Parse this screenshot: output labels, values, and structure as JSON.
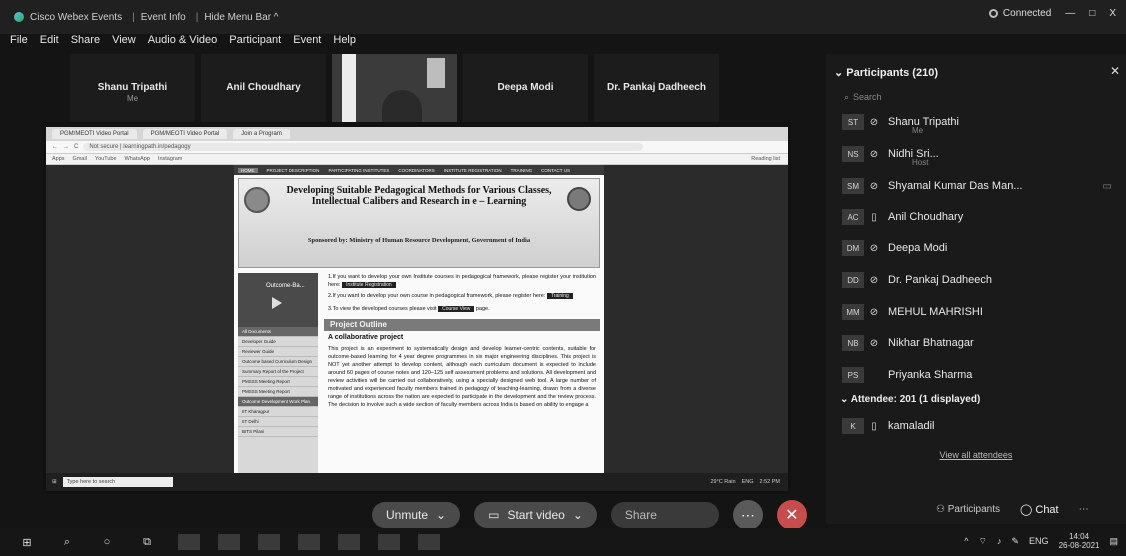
{
  "titlebar": {
    "app": "Cisco Webex Events",
    "sep1": "|",
    "event_info": "Event Info",
    "sep2": "|",
    "hide_menu": "Hide Menu Bar ^",
    "connected": "Connected",
    "min": "—",
    "max": "□",
    "close": "X"
  },
  "menu": [
    "File",
    "Edit",
    "Share",
    "View",
    "Audio & Video",
    "Participant",
    "Event",
    "Help"
  ],
  "video_strip": [
    {
      "name": "Shanu Tripathi",
      "sub": "Me"
    },
    {
      "name": "Anil Choudhary",
      "sub": ""
    },
    {
      "name": "Deepa Modi",
      "sub": ""
    },
    {
      "name": "Dr. Pankaj Dadheech",
      "sub": ""
    }
  ],
  "browser": {
    "tab1": "PGM/MEOTI Video Portal",
    "tab2": "PGM/MEOTI Video Portal",
    "tab3": "Join a Program",
    "url": "Not secure | learningpath.in/pedagogy",
    "bookmarks": [
      "Apps",
      "Gmail",
      "YouTube",
      "WhatsApp",
      "Instagram"
    ],
    "reading_list": "Reading list"
  },
  "site": {
    "nav": [
      "HOME",
      "PROJECT DESCRIPTION",
      "PARTICIPATING INSTITUTES",
      "COORDINATORS",
      "INSTITUTE REGISTRATION",
      "TRAINING",
      "CONTACT US"
    ],
    "title": "Developing Suitable Pedagogical Methods for Various Classes, Intellectual Calibers and Research in e – Learning",
    "sponsor": "Sponsored by: Ministry of Human Resource Development, Government of India",
    "side_video": "Outcome-Ba...",
    "side_items": [
      "All Documents",
      "Developer Guide",
      "Reviewer Guide",
      "Outcome based Curriculum Design",
      "Summary Report of the Project",
      "PMSSS Meeting Report",
      "PMSSS Meeting Report",
      "Outcome Development Work Plan",
      "IIT Kharagpur",
      "IIT Delhi",
      "BITS Pilani"
    ],
    "p1": "1.If you want to develop your own Institute courses in pedagogical framework, please register your institution here:",
    "p1_btn": "Institute Registration",
    "p2": "2.If you want to develop your own course in pedagogical framework, please register here:",
    "p2_btn": "Training",
    "p3": "3.To view the developed courses please visit",
    "p3_btn": "Course View",
    "p3_end": "page.",
    "outline": "Project Outline",
    "collab": "A collaborative project",
    "body": "This project is an experiment to systematically design and develop learner-centric contents, suitable for outcome-based learning for 4 year degree programmes in six major engineering disciplines. This project is NOT yet another attempt to develop content, although each curriculum document is expected to include around 60 pages of course notes and 120–125 self assessment problems and solutions. All development and review activities will be carried out collaboratively, using a specially designed web tool. A large number of motivated and experienced faculty members trained in pedagogy of teaching-learning, drawn from a diverse range of institutions across the nation are expected to participate in the development and the review process. The decision to involve such a wide section of faculty members across India is based on ability to engage a"
  },
  "inner_taskbar": {
    "search": "Type here to search",
    "weather": "29°C Rain",
    "lang": "ENG",
    "time": "2:52 PM"
  },
  "controls": {
    "unmute": "Unmute",
    "start_video": "Start video",
    "share": "Share"
  },
  "panel": {
    "header": "Participants (210)",
    "search": "Search",
    "participants": [
      {
        "initials": "ST",
        "name": "Shanu Tripathi",
        "sub": "Me"
      },
      {
        "initials": "NS",
        "name": "Nidhi Sri...",
        "sub": "Host"
      },
      {
        "initials": "SM",
        "name": "Shyamal Kumar Das Man...",
        "sub": ""
      },
      {
        "initials": "AC",
        "name": "Anil Choudhary",
        "sub": ""
      },
      {
        "initials": "DM",
        "name": "Deepa Modi",
        "sub": ""
      },
      {
        "initials": "DD",
        "name": "Dr. Pankaj Dadheech",
        "sub": ""
      },
      {
        "initials": "MM",
        "name": "MEHUL MAHRISHI",
        "sub": ""
      },
      {
        "initials": "NB",
        "name": "Nikhar Bhatnagar",
        "sub": ""
      },
      {
        "initials": "PS",
        "name": "Priyanka Sharma",
        "sub": ""
      }
    ],
    "attendee_header": "Attendee: 201 (1 displayed)",
    "attendee": {
      "initials": "K",
      "name": "kamaladil"
    },
    "view_all": "View all attendees",
    "participants_btn": "Participants",
    "chat_btn": "Chat"
  },
  "taskbar": {
    "lang": "ENG",
    "time": "14:04",
    "date": "26-08-2021"
  },
  "colors": {
    "end_call": "#c74d4d",
    "panel": "#1a1a1a"
  }
}
